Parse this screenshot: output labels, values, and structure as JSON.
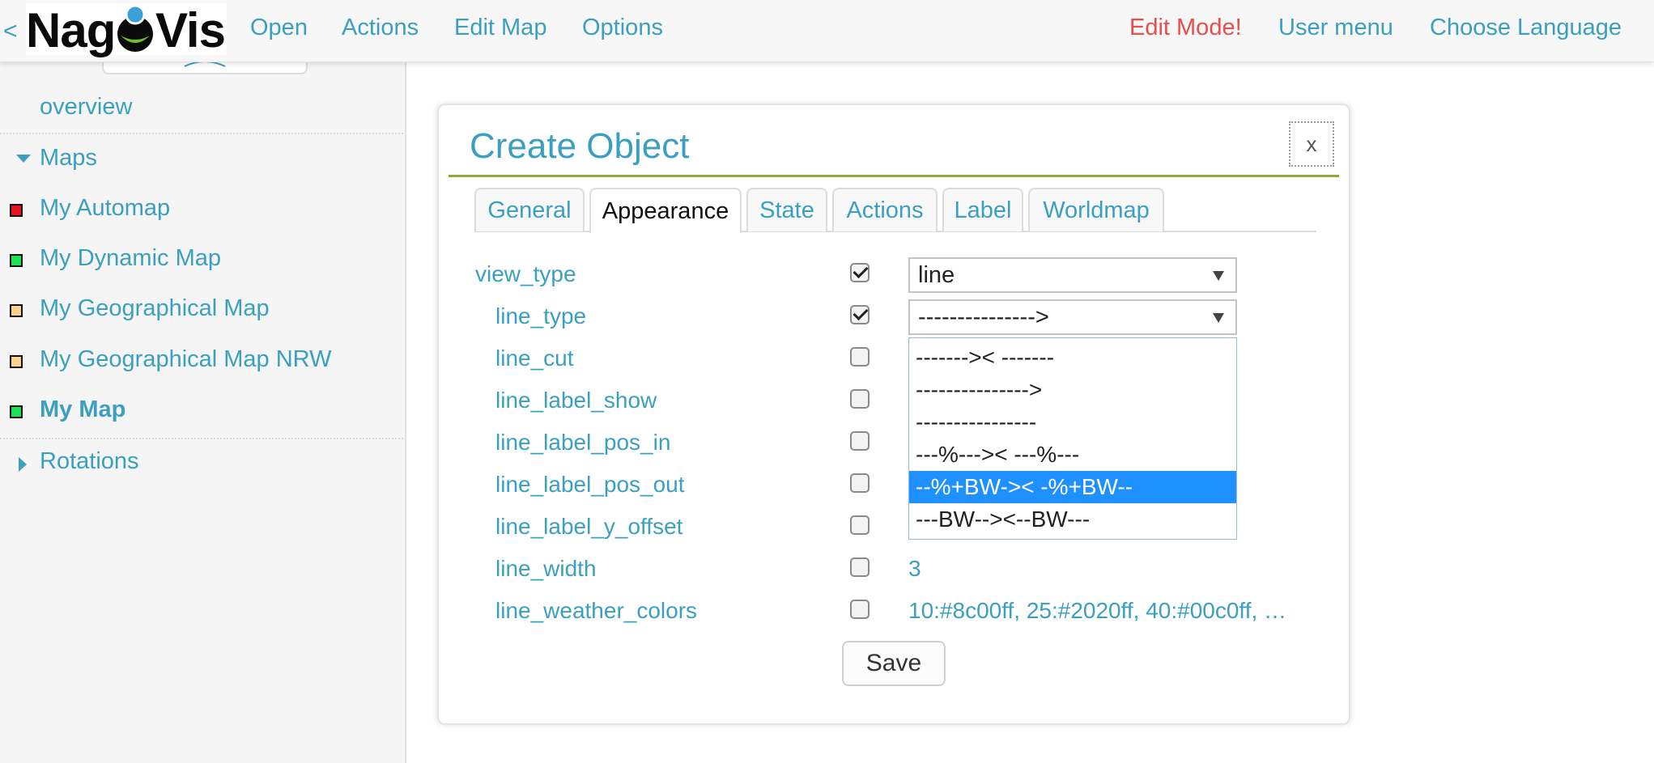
{
  "header": {
    "collapse_label": "<",
    "logo": {
      "part1": "Nag",
      "part2": "Vis"
    },
    "nav": [
      "Open",
      "Actions",
      "Edit Map",
      "Options"
    ],
    "right": {
      "edit_mode": "Edit Mode!",
      "user_menu": "User menu",
      "language": "Choose Language"
    }
  },
  "sidebar": {
    "overview": "overview",
    "maps_heading": "Maps",
    "maps": [
      {
        "label": "My Automap",
        "status_color": "#e8141b"
      },
      {
        "label": "My Dynamic Map",
        "status_color": "#1ee053"
      },
      {
        "label": "My Geographical Map",
        "status_color": "#fcd28a"
      },
      {
        "label": "My Geographical Map NRW",
        "status_color": "#fcd28a"
      },
      {
        "label": "My Map",
        "status_color": "#1ee053",
        "active": true
      }
    ],
    "rotations_heading": "Rotations"
  },
  "dialog": {
    "title": "Create Object",
    "close_label": "x",
    "tabs": [
      "General",
      "Appearance",
      "State",
      "Actions",
      "Label",
      "Worldmap"
    ],
    "active_tab": "Appearance",
    "props": [
      {
        "label": "view_type",
        "checked": true,
        "value": "line"
      },
      {
        "label": "line_type",
        "checked": true,
        "value": "--------------->"
      },
      {
        "label": "line_cut",
        "checked": false,
        "value": ""
      },
      {
        "label": "line_label_show",
        "checked": false,
        "value": ""
      },
      {
        "label": "line_label_pos_in",
        "checked": false,
        "value": ""
      },
      {
        "label": "line_label_pos_out",
        "checked": false,
        "value": ""
      },
      {
        "label": "line_label_y_offset",
        "checked": false,
        "value": ""
      },
      {
        "label": "line_width",
        "checked": false,
        "value": "3"
      },
      {
        "label": "line_weather_colors",
        "checked": false,
        "value": "10:#8c00ff, 25:#2020ff, 40:#00c0ff, …"
      }
    ],
    "line_type_options": [
      "------->< -------",
      "--------------->",
      "----------------",
      "---%--->< ---%---",
      "--%+BW->< -%+BW--",
      "---BW--><--BW---"
    ],
    "selected_option_index": 4,
    "save_label": "Save"
  },
  "colors": {
    "accent": "#3ba0c0",
    "warning": "#e94e4e",
    "rule": "#8fa83c",
    "selection": "#1e90ff"
  }
}
